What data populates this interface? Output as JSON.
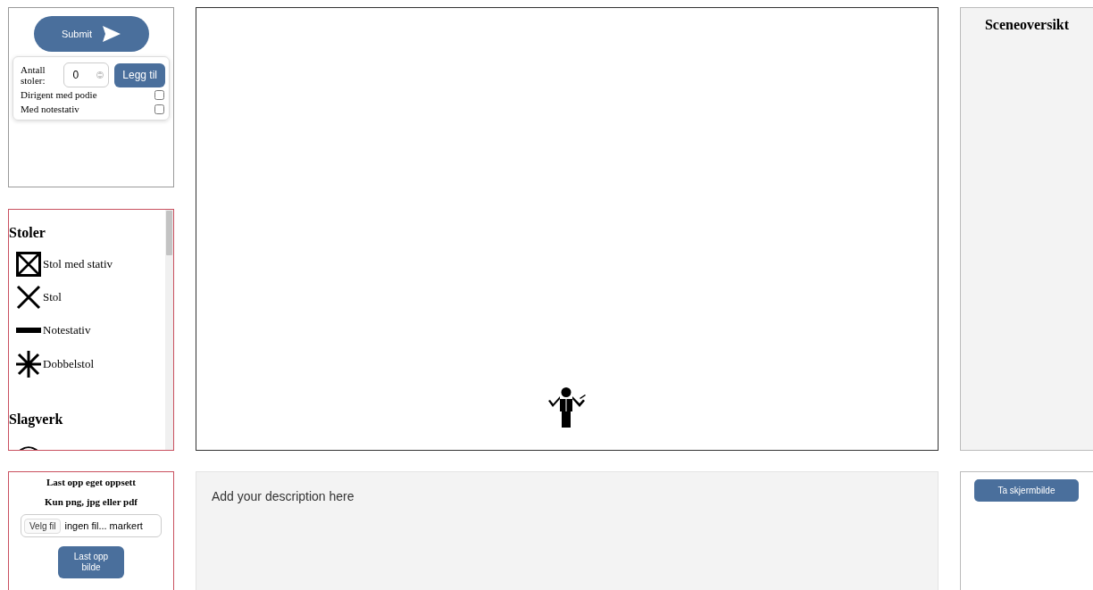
{
  "controls": {
    "submit_button": "Submit",
    "chair_count": {
      "label": "Antall stoler:",
      "value": "0"
    },
    "add_button": "Legg til",
    "options": [
      {
        "label": "Dirigent med podie",
        "checked": false
      },
      {
        "label": "Med notestativ",
        "checked": false
      }
    ]
  },
  "palette": {
    "sections": [
      {
        "title": "Stoler",
        "items": [
          {
            "kind": "chair_stand",
            "label": "Stol med stativ"
          },
          {
            "kind": "chair",
            "label": "Stol"
          },
          {
            "kind": "stand",
            "label": "Notestativ"
          },
          {
            "kind": "double_chair",
            "label": "Dobbelstol"
          }
        ]
      },
      {
        "title": "Slagverk",
        "items": [
          {
            "kind": "drum"
          }
        ]
      }
    ]
  },
  "stage": {
    "figures": [
      {
        "kind": "conductor"
      }
    ]
  },
  "overview": {
    "title": "Sceneoversikt"
  },
  "upload": {
    "title": "Last opp eget oppsett",
    "note": "Kun png, jpg eller pdf",
    "file_button": "Velg fil",
    "file_status": "ingen fil... markert",
    "upload_button": "Last opp bilde"
  },
  "description": {
    "placeholder": "Add your description here"
  },
  "screenshot_button": "Ta skjermbilde"
}
